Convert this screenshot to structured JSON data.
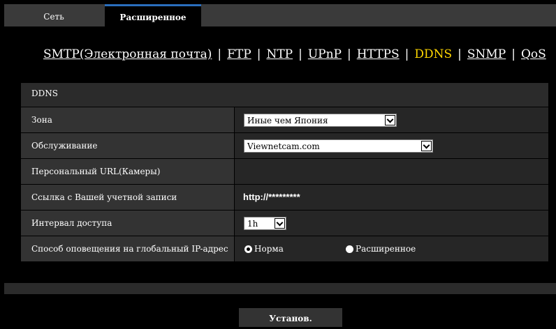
{
  "tabs": {
    "basic": "Сеть",
    "advanced": "Расширенное"
  },
  "nav": {
    "smtp": "SMTP(Электронная почта)",
    "ftp": "FTP",
    "ntp": "NTP",
    "upnp": "UPnP",
    "https": "HTTPS",
    "ddns": "DDNS",
    "snmp": "SNMP",
    "qos": "QoS",
    "sep": "|"
  },
  "section": {
    "title": "DDNS"
  },
  "rows": {
    "zone": {
      "label": "Зона",
      "value": "Иные чем Япония"
    },
    "service": {
      "label": "Обслуживание",
      "value": "Viewnetcam.com"
    },
    "personal_url": {
      "label": "Персональный URL(Камеры)"
    },
    "account_link": {
      "label": "Ссылка с Вашей учетной записи",
      "value": "http://*********"
    },
    "interval": {
      "label": "Интервал доступа",
      "value": "1h"
    },
    "notify": {
      "label": "Способ оповещения на глобальный IP-адрес",
      "option_normal": "Норма",
      "option_advanced": "Расширенное",
      "selected": "Норма"
    }
  },
  "buttons": {
    "set": "Установ."
  }
}
